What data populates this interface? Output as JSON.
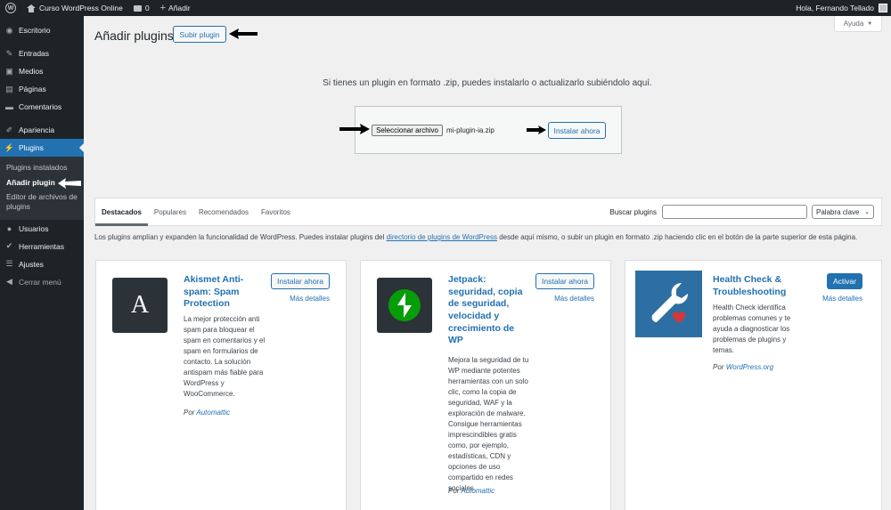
{
  "admin_bar": {
    "site_name": "Curso WordPress Online",
    "comments_count": "0",
    "new_label": "Añadir",
    "greeting": "Hola, Fernando Tellado"
  },
  "sidebar": {
    "items": [
      {
        "label": "Escritorio",
        "icon": "dashboard-icon"
      },
      {
        "label": "Entradas",
        "icon": "pin-icon"
      },
      {
        "label": "Medios",
        "icon": "media-icon"
      },
      {
        "label": "Páginas",
        "icon": "page-icon"
      },
      {
        "label": "Comentarios",
        "icon": "comment-icon"
      },
      {
        "label": "Apariencia",
        "icon": "brush-icon"
      },
      {
        "label": "Plugins",
        "icon": "plugin-icon"
      },
      {
        "label": "Usuarios",
        "icon": "user-icon"
      },
      {
        "label": "Herramientas",
        "icon": "wrench-icon"
      },
      {
        "label": "Ajustes",
        "icon": "settings-icon"
      },
      {
        "label": "Cerrar menú",
        "icon": "collapse-icon"
      }
    ],
    "submenu": [
      "Plugins instalados",
      "Añadir plugin",
      "Editor de archivos de plugins"
    ]
  },
  "header": {
    "title": "Añadir plugins",
    "upload_label": "Subir plugin",
    "help_label": "Ayuda"
  },
  "upload": {
    "text": "Si tienes un plugin en formato .zip, puedes instalarlo o actualizarlo subiéndolo aquí.",
    "file_button": "Seleccionar archivo",
    "file_name": "mi-plugin-ia.zip",
    "install_label": "Instalar ahora"
  },
  "filter": {
    "tabs": [
      "Destacados",
      "Populares",
      "Recomendados",
      "Favoritos"
    ],
    "search_label": "Buscar plugins",
    "search_value": "",
    "select_value": "Palabra clave"
  },
  "intro": {
    "before": "Los plugins amplían y expanden la funcionalidad de WordPress. Puedes instalar plugins del ",
    "link": "directorio de plugins de WordPress",
    "after": " desde aquí mismo, o subir un plugin en formato .zip haciendo clic en el botón de la parte superior de esta página."
  },
  "cards": [
    {
      "name": "Akismet Anti-spam: Spam Protection",
      "description": "La mejor protección anti spam para bloquear el spam en comentarios y el spam en formularios de contacto. La solución antispam más fiable para WordPress y WooCommerce.",
      "author_prefix": "Por",
      "author": "Automattic",
      "action": "Instalar ahora",
      "details": "Más detalles",
      "icon_letter": "A"
    },
    {
      "name": "Jetpack: seguridad, copia de seguridad, velocidad y crecimiento de WP",
      "description": "Mejora la seguridad de tu WP mediante potentes herramientas con un solo clic, como la copia de seguridad, WAF y la exploración de malware. Consigue herramientas imprescindibles gratis como, por ejemplo, estadísticas, CDN y opciones de uso compartido en redes sociales.",
      "author_prefix": "Por",
      "author": "Automattic",
      "action": "Instalar ahora",
      "details": "Más detalles"
    },
    {
      "name": "Health Check & Troubleshooting",
      "description": "Health Check identifica problemas comunes y te ayuda a diagnosticar los problemas de plugins y temas.",
      "author_prefix": "Por",
      "author": "WordPress.org",
      "action": "Activar",
      "details": "Más detalles"
    }
  ],
  "colors": {
    "accent": "#2271b1",
    "sidebar_bg": "#1d2327",
    "jetpack_green": "#069e08",
    "health_blue": "#2e6fa3"
  }
}
